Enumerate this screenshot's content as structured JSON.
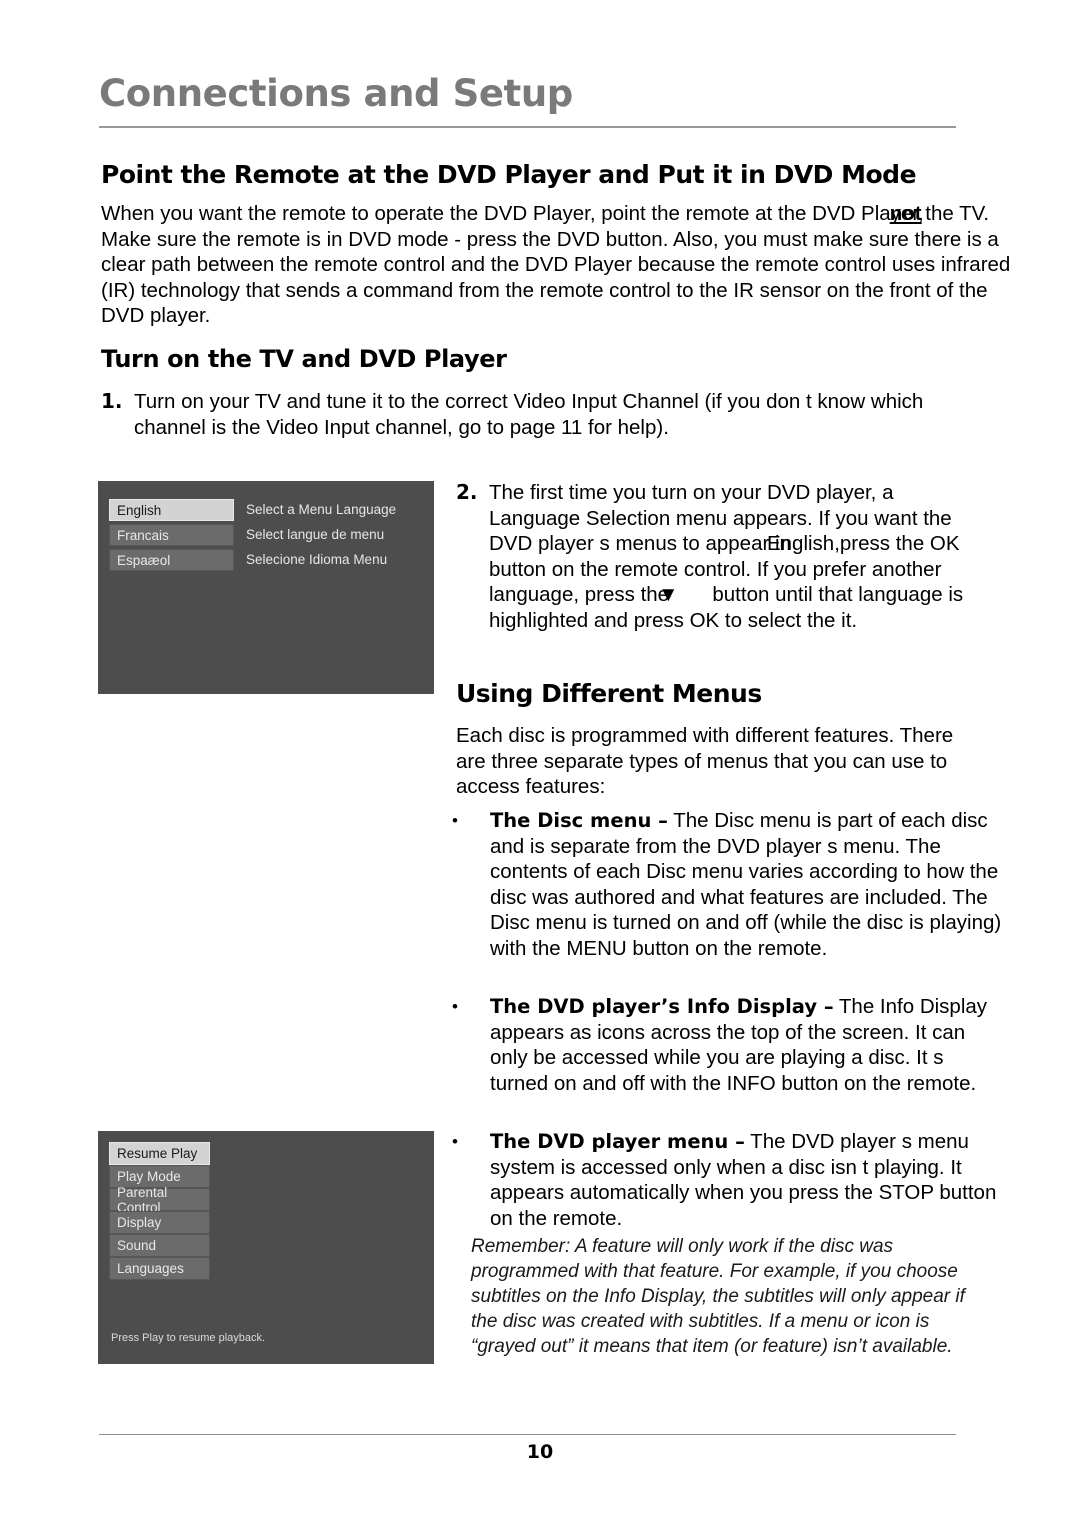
{
  "header": {
    "chapter_title": "Connections and Setup"
  },
  "sections": {
    "heading_point_remote": "Point the Remote at the DVD Player and Put it in DVD Mode",
    "intro_paragraph_part1": "When you want the remote to operate the DVD Player, point the remote at the DVD Player,",
    "intro_overlap_word": "not",
    "intro_paragraph_part2": "the TV. Make sure the remote is in DVD mode - press the DVD button. Also, you must make sure there is a clear path between the remote control and the DVD Player because the remote control uses infrared (IR) technology that sends a command from the remote control to the IR sensor on the front of the DVD player.",
    "heading_turn_on": "Turn on the TV and DVD Player",
    "heading_using_menus": "Using Different Menus",
    "menus_intro": "Each disc is programmed with different features. There are three separate types of menus that you can use to access features:"
  },
  "numbered_steps": [
    {
      "number": "1.",
      "text": "Turn on your TV and tune it to the correct Video Input Channel (if you don t know which channel is the Video Input channel, go to page 11 for help)."
    },
    {
      "number": "2.",
      "text_part1": "The first time you turn on your DVD player, a Language Selection menu appears. If you want the DVD player s menus to appear in",
      "text_overlap": "English,",
      "text_part2": "press the OK button on the remote control. If you prefer another language, press the",
      "arrow_glyph": "▼",
      "text_part3": "button until that language is highlighted and press OK to select the it."
    }
  ],
  "bullets": [
    {
      "bullet": "•",
      "bold_lead": "The Disc menu –",
      "text": "The Disc menu is part of each disc and is separate from the DVD player s menu. The contents of each Disc menu varies according to how the disc was authored and what features are included. The Disc menu is turned on and off (while the disc is playing) with the MENU button on the remote."
    },
    {
      "bullet": "•",
      "bold_lead": "The DVD player’s Info Display –",
      "text": "The Info Display appears as icons across the top of the screen. It can only be accessed while you are playing a disc. It s turned on and off with the INFO button on the remote."
    },
    {
      "bullet": "•",
      "bold_lead": "The DVD player menu –",
      "text": "The DVD player s menu system is accessed only when a disc isn t playing. It appears automatically when you press the STOP button on the remote."
    }
  ],
  "remember_note": "Remember: A feature will only work if the disc was programmed with that feature. For example, if you choose subtitles on the Info Display, the subtitles will only appear if the disc was created with subtitles. If a menu or icon is “grayed out” it means that item (or feature) isn’t available.",
  "language_screen": {
    "options": [
      {
        "label": "English",
        "selected": true
      },
      {
        "label": "Francais",
        "selected": false
      },
      {
        "label": "Espaæol",
        "selected": false
      }
    ],
    "prompts": [
      "Select a Menu Language",
      "Select langue de menu",
      "Selecione Idioma Menu"
    ]
  },
  "player_menu_screen": {
    "items": [
      {
        "label": "Resume Play",
        "selected": true
      },
      {
        "label": "Play Mode",
        "selected": false
      },
      {
        "label": "Parental Control",
        "selected": false
      },
      {
        "label": "Display",
        "selected": false
      },
      {
        "label": "Sound",
        "selected": false
      },
      {
        "label": "Languages",
        "selected": false
      }
    ],
    "footer": "Press Play to resume playback."
  },
  "footer": {
    "page_number": "10"
  },
  "colors": {
    "chapter_title": "#7a7a7a",
    "osd_background": "#4d4d4d",
    "osd_row": "#6b6b6b",
    "osd_row_selected": "#d3d3d3",
    "rule": "#9a9a9a"
  }
}
